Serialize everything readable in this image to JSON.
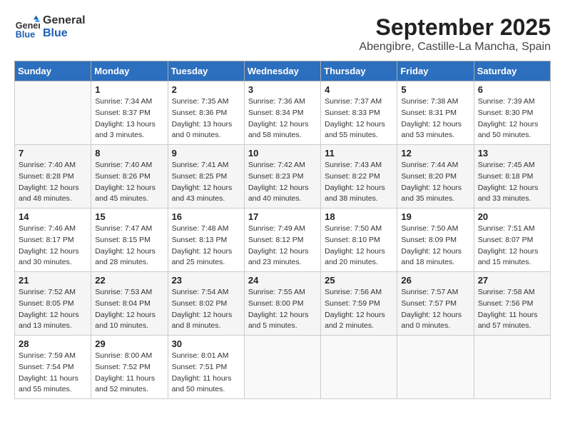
{
  "header": {
    "logo_line1": "General",
    "logo_line2": "Blue",
    "month": "September 2025",
    "location": "Abengibre, Castille-La Mancha, Spain"
  },
  "weekdays": [
    "Sunday",
    "Monday",
    "Tuesday",
    "Wednesday",
    "Thursday",
    "Friday",
    "Saturday"
  ],
  "weeks": [
    [
      {
        "day": "",
        "info": ""
      },
      {
        "day": "1",
        "info": "Sunrise: 7:34 AM\nSunset: 8:37 PM\nDaylight: 13 hours\nand 3 minutes."
      },
      {
        "day": "2",
        "info": "Sunrise: 7:35 AM\nSunset: 8:36 PM\nDaylight: 13 hours\nand 0 minutes."
      },
      {
        "day": "3",
        "info": "Sunrise: 7:36 AM\nSunset: 8:34 PM\nDaylight: 12 hours\nand 58 minutes."
      },
      {
        "day": "4",
        "info": "Sunrise: 7:37 AM\nSunset: 8:33 PM\nDaylight: 12 hours\nand 55 minutes."
      },
      {
        "day": "5",
        "info": "Sunrise: 7:38 AM\nSunset: 8:31 PM\nDaylight: 12 hours\nand 53 minutes."
      },
      {
        "day": "6",
        "info": "Sunrise: 7:39 AM\nSunset: 8:30 PM\nDaylight: 12 hours\nand 50 minutes."
      }
    ],
    [
      {
        "day": "7",
        "info": "Sunrise: 7:40 AM\nSunset: 8:28 PM\nDaylight: 12 hours\nand 48 minutes."
      },
      {
        "day": "8",
        "info": "Sunrise: 7:40 AM\nSunset: 8:26 PM\nDaylight: 12 hours\nand 45 minutes."
      },
      {
        "day": "9",
        "info": "Sunrise: 7:41 AM\nSunset: 8:25 PM\nDaylight: 12 hours\nand 43 minutes."
      },
      {
        "day": "10",
        "info": "Sunrise: 7:42 AM\nSunset: 8:23 PM\nDaylight: 12 hours\nand 40 minutes."
      },
      {
        "day": "11",
        "info": "Sunrise: 7:43 AM\nSunset: 8:22 PM\nDaylight: 12 hours\nand 38 minutes."
      },
      {
        "day": "12",
        "info": "Sunrise: 7:44 AM\nSunset: 8:20 PM\nDaylight: 12 hours\nand 35 minutes."
      },
      {
        "day": "13",
        "info": "Sunrise: 7:45 AM\nSunset: 8:18 PM\nDaylight: 12 hours\nand 33 minutes."
      }
    ],
    [
      {
        "day": "14",
        "info": "Sunrise: 7:46 AM\nSunset: 8:17 PM\nDaylight: 12 hours\nand 30 minutes."
      },
      {
        "day": "15",
        "info": "Sunrise: 7:47 AM\nSunset: 8:15 PM\nDaylight: 12 hours\nand 28 minutes."
      },
      {
        "day": "16",
        "info": "Sunrise: 7:48 AM\nSunset: 8:13 PM\nDaylight: 12 hours\nand 25 minutes."
      },
      {
        "day": "17",
        "info": "Sunrise: 7:49 AM\nSunset: 8:12 PM\nDaylight: 12 hours\nand 23 minutes."
      },
      {
        "day": "18",
        "info": "Sunrise: 7:50 AM\nSunset: 8:10 PM\nDaylight: 12 hours\nand 20 minutes."
      },
      {
        "day": "19",
        "info": "Sunrise: 7:50 AM\nSunset: 8:09 PM\nDaylight: 12 hours\nand 18 minutes."
      },
      {
        "day": "20",
        "info": "Sunrise: 7:51 AM\nSunset: 8:07 PM\nDaylight: 12 hours\nand 15 minutes."
      }
    ],
    [
      {
        "day": "21",
        "info": "Sunrise: 7:52 AM\nSunset: 8:05 PM\nDaylight: 12 hours\nand 13 minutes."
      },
      {
        "day": "22",
        "info": "Sunrise: 7:53 AM\nSunset: 8:04 PM\nDaylight: 12 hours\nand 10 minutes."
      },
      {
        "day": "23",
        "info": "Sunrise: 7:54 AM\nSunset: 8:02 PM\nDaylight: 12 hours\nand 8 minutes."
      },
      {
        "day": "24",
        "info": "Sunrise: 7:55 AM\nSunset: 8:00 PM\nDaylight: 12 hours\nand 5 minutes."
      },
      {
        "day": "25",
        "info": "Sunrise: 7:56 AM\nSunset: 7:59 PM\nDaylight: 12 hours\nand 2 minutes."
      },
      {
        "day": "26",
        "info": "Sunrise: 7:57 AM\nSunset: 7:57 PM\nDaylight: 12 hours\nand 0 minutes."
      },
      {
        "day": "27",
        "info": "Sunrise: 7:58 AM\nSunset: 7:56 PM\nDaylight: 11 hours\nand 57 minutes."
      }
    ],
    [
      {
        "day": "28",
        "info": "Sunrise: 7:59 AM\nSunset: 7:54 PM\nDaylight: 11 hours\nand 55 minutes."
      },
      {
        "day": "29",
        "info": "Sunrise: 8:00 AM\nSunset: 7:52 PM\nDaylight: 11 hours\nand 52 minutes."
      },
      {
        "day": "30",
        "info": "Sunrise: 8:01 AM\nSunset: 7:51 PM\nDaylight: 11 hours\nand 50 minutes."
      },
      {
        "day": "",
        "info": ""
      },
      {
        "day": "",
        "info": ""
      },
      {
        "day": "",
        "info": ""
      },
      {
        "day": "",
        "info": ""
      }
    ]
  ]
}
